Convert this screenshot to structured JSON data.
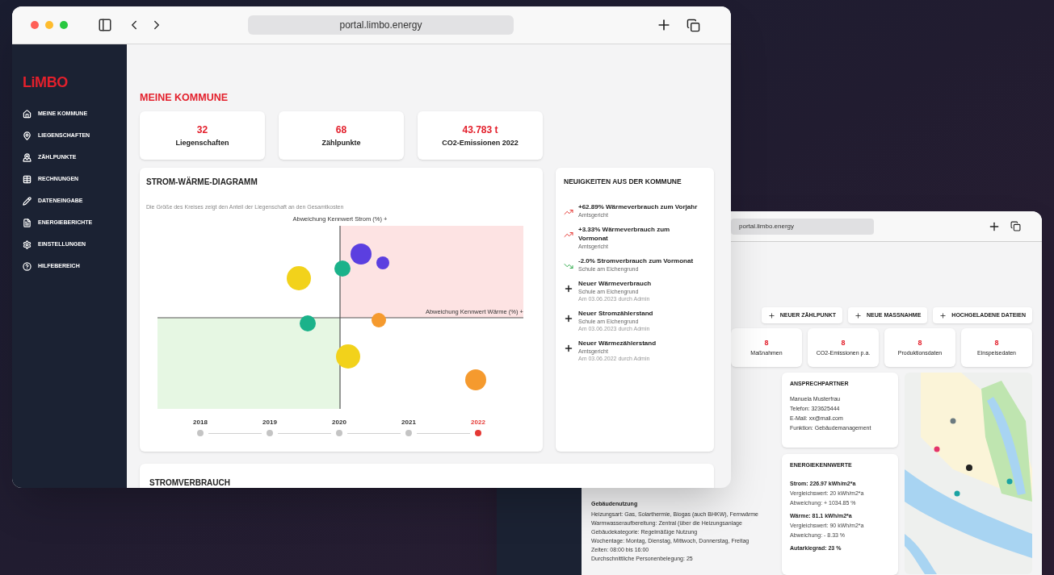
{
  "front_window": {
    "url": "portal.limbo.energy"
  },
  "sidebar": {
    "logo": "LiMBO",
    "items": [
      {
        "label": "MEINE KOMMUNE"
      },
      {
        "label": "LIEGENSCHAFTEN"
      },
      {
        "label": "ZÄHLPUNKTE"
      },
      {
        "label": "RECHNUNGEN"
      },
      {
        "label": "DATENEINGABE"
      },
      {
        "label": "ENERGIEBERICHTE"
      },
      {
        "label": "EINSTELLUNGEN"
      },
      {
        "label": "HILFEBEREICH"
      }
    ]
  },
  "page": {
    "title": "MEINE KOMMUNE",
    "stats": [
      {
        "value": "32",
        "label": "Liegenschaften"
      },
      {
        "value": "68",
        "label": "Zählpunkte"
      },
      {
        "value": "43.783 t",
        "label": "CO2-Emissionen 2022"
      }
    ]
  },
  "chart_panel": {
    "title": "STROM-WÄRME-DIAGRAMM",
    "subtitle": "Die Größe des Kreises zeigt den Anteil der Liegenschaft an den Gesamtkosten",
    "y_axis_label": "Abweichung Kennwert Strom (%) +",
    "x_axis_label": "Abweichung Kennwert Wärme (%) +",
    "years": [
      {
        "label": "2018",
        "selected": false
      },
      {
        "label": "2019",
        "selected": false
      },
      {
        "label": "2020",
        "selected": false
      },
      {
        "label": "2021",
        "selected": false
      },
      {
        "label": "2022",
        "selected": true
      }
    ]
  },
  "news": {
    "title": "NEUIGKEITEN AUS DER KOMMUNE",
    "items": [
      {
        "kind": "up",
        "title": "+62.89% Wärmeverbrauch zum Vorjahr",
        "subtitle": "Amtsgericht"
      },
      {
        "kind": "up",
        "title": "+3.33% Wärmeverbrauch zum Vormonat",
        "subtitle": "Amtsgericht"
      },
      {
        "kind": "down",
        "title": "-2.0% Stromverbrauch zum Vormonat",
        "subtitle": "Schule am Eichengrund"
      },
      {
        "kind": "new",
        "title": "Neuer Wärmeverbrauch",
        "subtitle": "Schule am Eichengrund",
        "meta": "Am 03.06.2023 durch Admin"
      },
      {
        "kind": "new",
        "title": "Neuer Stromzählerstand",
        "subtitle": "Schule am Eichengrund",
        "meta": "Am 03.06.2023 durch Admin"
      },
      {
        "kind": "new",
        "title": "Neuer Wärmezählerstand",
        "subtitle": "Amtsgericht",
        "meta": "Am 03.06.2022 durch Admin"
      }
    ]
  },
  "next_section": {
    "title": "STROMVERBRAUCH"
  },
  "back_window": {
    "url": "portal.limbo.energy",
    "actions": [
      {
        "label": "NEUER ZÄHLPUNKT"
      },
      {
        "label": "NEUE MASSNAHME"
      },
      {
        "label": "HOCHGELADENE DATEIEN"
      }
    ],
    "stats": [
      {
        "value": "8",
        "label": "Maßnahmen"
      },
      {
        "value": "8",
        "label": "CO2-Emissionen p.a."
      },
      {
        "value": "8",
        "label": "Produktionsdaten"
      },
      {
        "value": "8",
        "label": "Einspeisedaten"
      }
    ],
    "usage": {
      "title": "Gebäudenutzung",
      "lines": [
        "Heizungsart: Gas, Solarthermie, Biogas (auch BHKW), Fernwärme",
        "Warmwasseraufbereitung: Zentral (über die Heizungsanlage",
        "Gebäudekategorie: Regelmäßige Nutzung",
        "Wochentage: Montag, Dienstag, Mittwoch, Donnerstag, Freitag",
        "Zeiten: 08:00 bis 16:00",
        "Durchschnittliche Personenbelegung: 25"
      ]
    },
    "contact": {
      "title": "ANSPRECHPARTNER",
      "lines": [
        "Manuela Musterfrau",
        "Telefon: 323625444",
        "E-Mail: xx@mail.com",
        "Funktion: Gebäudemanagement"
      ]
    },
    "energy": {
      "title": "ENERGIEKENNWERTE",
      "lines": [
        {
          "kind": "value",
          "text": "Strom: 226.97 kWh/m2*a"
        },
        {
          "kind": "detail",
          "text": "Vergleichswert: 20 kWh/m2*a"
        },
        {
          "kind": "detail",
          "text": "Abweichung: + 1034.85 %"
        },
        {
          "kind": "value",
          "text": "Wärme: 81.1 kWh/m2*a"
        },
        {
          "kind": "detail",
          "text": "Vergleichswert: 90 kWh/m2*a"
        },
        {
          "kind": "detail",
          "text": "Abweichung: - 8.33 %"
        },
        {
          "kind": "value",
          "text": "Autarkiegrad: 23 %"
        }
      ]
    }
  }
}
